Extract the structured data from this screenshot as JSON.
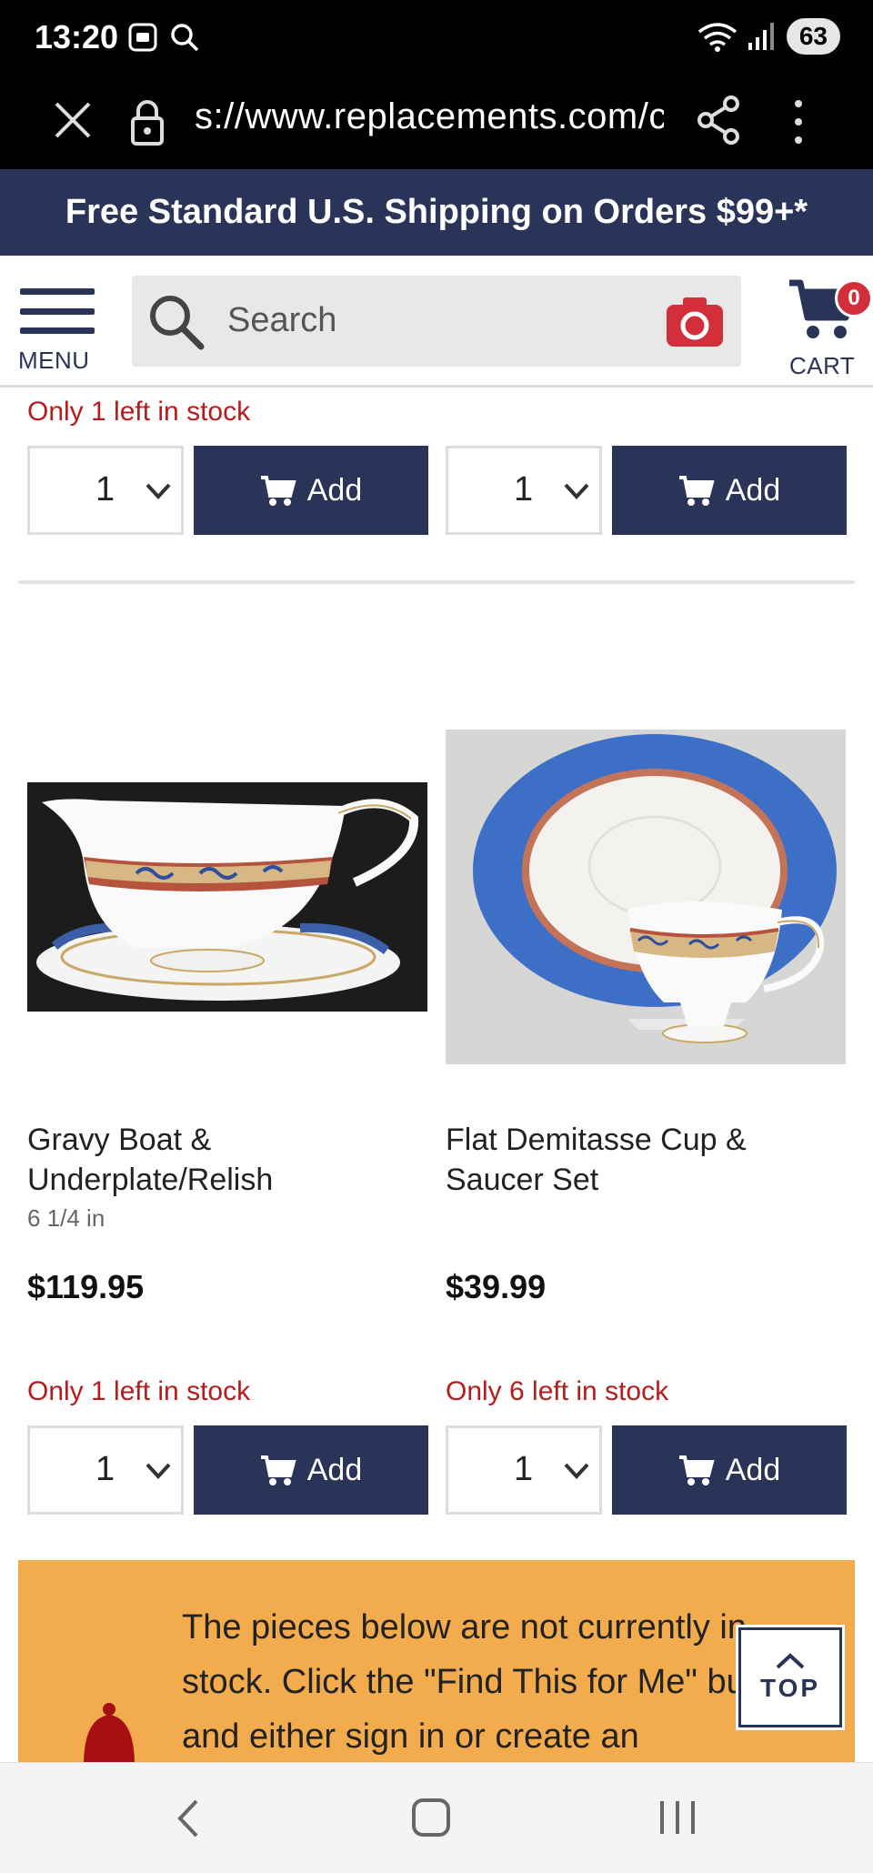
{
  "status_bar": {
    "time": "13:20",
    "battery": "63"
  },
  "browser": {
    "url": "s://www.replacements.com/c"
  },
  "promo": {
    "text": "Free Standard U.S. Shipping on Orders $99+*"
  },
  "header": {
    "menu_label": "MENU",
    "search_placeholder": "Search",
    "cart_label": "CART",
    "cart_count": "0"
  },
  "top_row": {
    "left": {
      "stock": "Only 1 left in stock",
      "qty": "1",
      "add_label": "Add"
    },
    "right": {
      "qty": "1",
      "add_label": "Add"
    }
  },
  "products": [
    {
      "title": "Gravy Boat & Underplate/Relish",
      "size": "6 1/4 in",
      "price": "$119.95",
      "stock": "Only 1 left in stock",
      "qty": "1",
      "add_label": "Add"
    },
    {
      "title": "Flat Demitasse Cup & Saucer Set",
      "size": "",
      "price": "$39.99",
      "stock": "Only 6 left in stock",
      "qty": "1",
      "add_label": "Add"
    }
  ],
  "notice": {
    "text": "The pieces below are not currently in stock. Click the \"Find This for Me\" button and either sign in or create an"
  },
  "top_button": {
    "label": "TOP"
  },
  "colors": {
    "navy": "#2a3459",
    "stock_red": "#b71c1c",
    "notice_orange": "#f2ac4d",
    "camera_red": "#d32f3b"
  }
}
